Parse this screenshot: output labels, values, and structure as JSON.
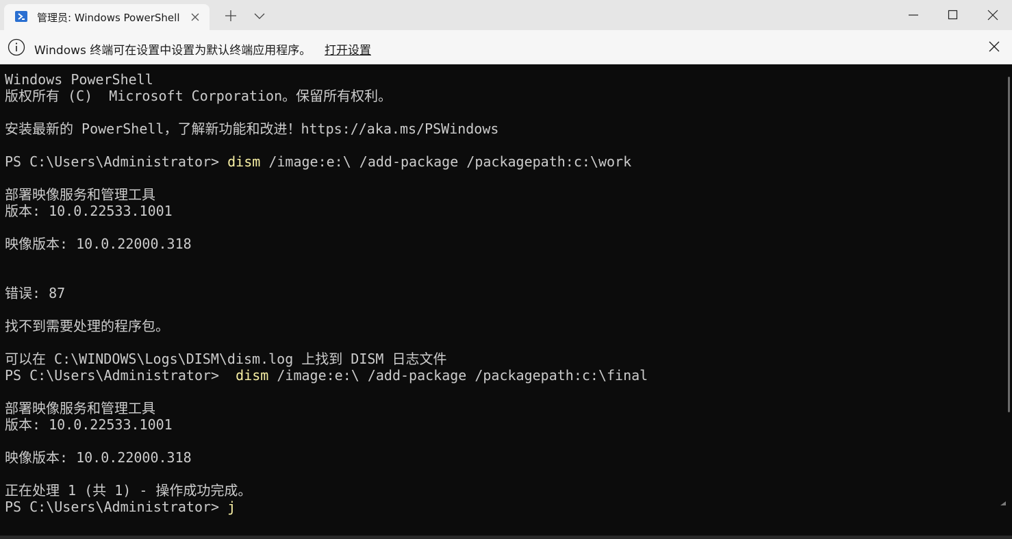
{
  "tab": {
    "title": "管理员: Windows PowerShell",
    "icon": "powershell-icon"
  },
  "infobar": {
    "message": "Windows 终端可在设置中设置为默认终端应用程序。",
    "link": "打开设置"
  },
  "terminal": {
    "lines": [
      {
        "text": "Windows PowerShell"
      },
      {
        "text": "版权所有 (C)  Microsoft Corporation。保留所有权利。"
      },
      {
        "text": ""
      },
      {
        "text": "安装最新的 PowerShell，了解新功能和改进！https://aka.ms/PSWindows"
      },
      {
        "text": ""
      },
      {
        "prompt": "PS C:\\Users\\Administrator> ",
        "cmd": "dism",
        "args": " /image:e:\\ /add-package /packagepath:c:\\work"
      },
      {
        "text": ""
      },
      {
        "text": "部署映像服务和管理工具"
      },
      {
        "text": "版本: 10.0.22533.1001"
      },
      {
        "text": ""
      },
      {
        "text": "映像版本: 10.0.22000.318"
      },
      {
        "text": ""
      },
      {
        "text": ""
      },
      {
        "text": "错误: 87"
      },
      {
        "text": ""
      },
      {
        "text": "找不到需要处理的程序包。"
      },
      {
        "text": ""
      },
      {
        "text": "可以在 C:\\WINDOWS\\Logs\\DISM\\dism.log 上找到 DISM 日志文件"
      },
      {
        "prompt": "PS C:\\Users\\Administrator>  ",
        "cmd": "dism",
        "args": " /image:e:\\ /add-package /packagepath:c:\\final"
      },
      {
        "text": ""
      },
      {
        "text": "部署映像服务和管理工具"
      },
      {
        "text": "版本: 10.0.22533.1001"
      },
      {
        "text": ""
      },
      {
        "text": "映像版本: 10.0.22000.318"
      },
      {
        "text": ""
      },
      {
        "text": "正在处理 1 (共 1) - 操作成功完成。"
      },
      {
        "prompt": "PS C:\\Users\\Administrator> ",
        "cmd": "j",
        "args": ""
      }
    ]
  },
  "colors": {
    "terminal_bg": "#0c0c0c",
    "terminal_fg": "#cccccc",
    "command": "#f9f1a5",
    "tabbar_bg": "#e6e6e6",
    "tab_bg": "#f6f6f6"
  }
}
